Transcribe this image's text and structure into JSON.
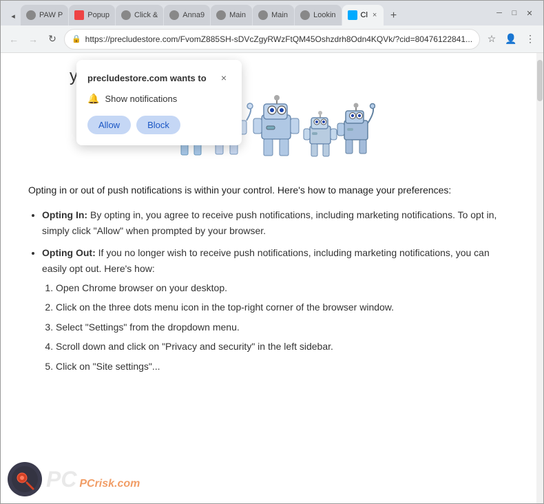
{
  "browser": {
    "tabs": [
      {
        "id": "tab1",
        "label": "PAW P",
        "favicon_color": "#888",
        "active": false,
        "closable": false
      },
      {
        "id": "tab2",
        "label": "Popup",
        "favicon_color": "#e44",
        "active": false,
        "closable": false
      },
      {
        "id": "tab3",
        "label": "Click &",
        "favicon_color": "#888",
        "active": false,
        "closable": false
      },
      {
        "id": "tab4",
        "label": "Anna9",
        "favicon_color": "#888",
        "active": false,
        "closable": false
      },
      {
        "id": "tab5",
        "label": "Main",
        "favicon_color": "#888",
        "active": false,
        "closable": false
      },
      {
        "id": "tab6",
        "label": "Main",
        "favicon_color": "#888",
        "active": false,
        "closable": false
      },
      {
        "id": "tab7",
        "label": "Lookin",
        "favicon_color": "#888",
        "active": false,
        "closable": false
      },
      {
        "id": "tab8",
        "label": "Cl",
        "favicon_color": "#0af",
        "active": true,
        "closable": true
      }
    ],
    "address": "https://precludestore.com/FvomZ885SH-sDVcZgyRWzFtQM45Oshzdrh8Odn4KQVk/?cid=80476122841...",
    "back_enabled": false,
    "forward_enabled": false
  },
  "notification_popup": {
    "title": "precludestore.com wants to",
    "notification_label": "Show notifications",
    "allow_label": "Allow",
    "block_label": "Block"
  },
  "page": {
    "heading": "you are not   a robot",
    "intro": "Opting in or out of push notifications is within your control. Here's how to manage your preferences:",
    "list": [
      {
        "term": "Opting In:",
        "desc": "By opting in, you agree to receive push notifications, including marketing notifications. To opt in, simply click \"Allow\" when prompted by your browser."
      },
      {
        "term": "Opting Out:",
        "desc": "If you no longer wish to receive push notifications, including marketing notifications, you can easily opt out. Here's how:",
        "sub_steps": [
          "Open Chrome browser on your desktop.",
          "Click on the three dots menu icon in the top-right corner of the browser window.",
          "Select \"Settings\" from the dropdown menu.",
          "Scroll down and click on \"Privacy and security\" in the left sidebar.",
          "Click on \"Site settings\"..."
        ]
      }
    ]
  },
  "pcrisk": {
    "domain": "PCrisk.com"
  },
  "icons": {
    "back": "←",
    "forward": "→",
    "refresh": "↻",
    "lock": "🔒",
    "star": "☆",
    "profile": "👤",
    "menu": "⋮",
    "close": "×",
    "bell": "🔔",
    "new_tab": "+"
  }
}
